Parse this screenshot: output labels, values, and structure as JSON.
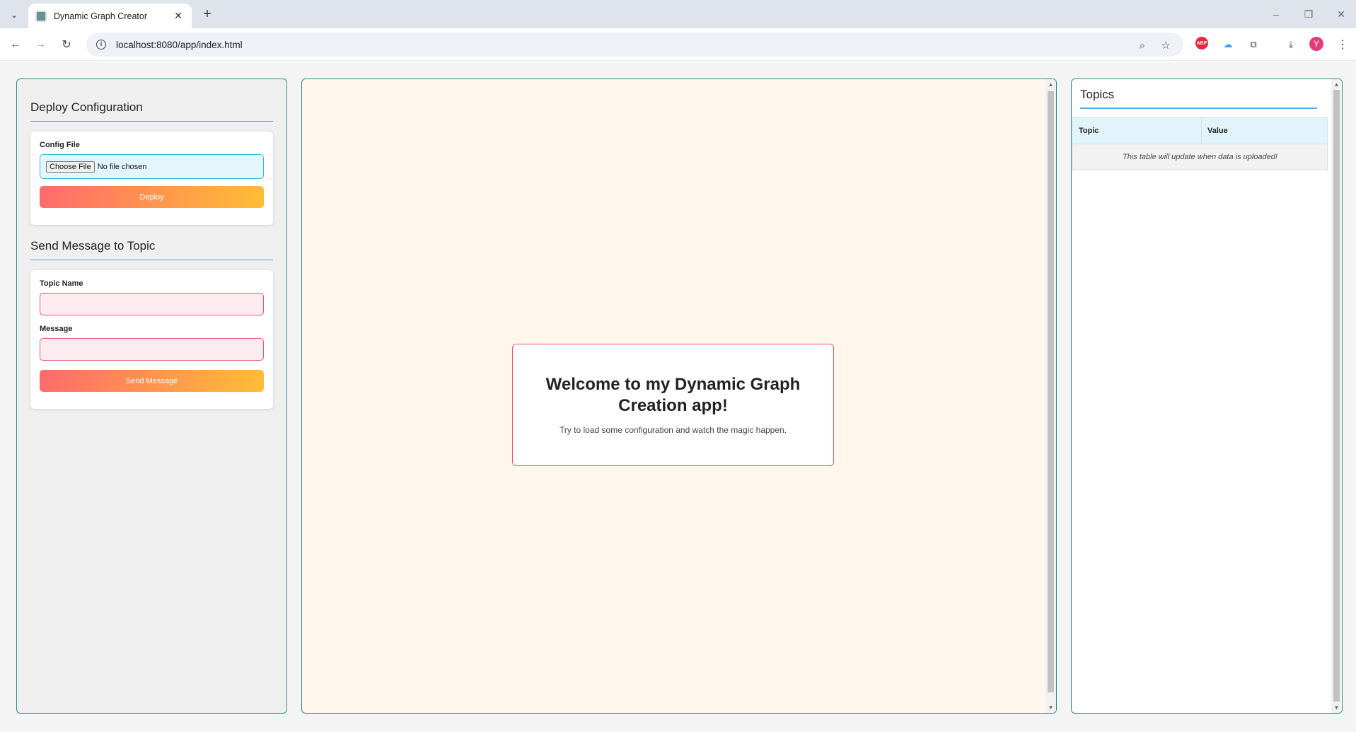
{
  "browser": {
    "tab_title": "Dynamic Graph Creator",
    "url": "localhost:8080/app/index.html",
    "profile_initial": "Y",
    "adblock_label": "ABP"
  },
  "left_panel": {
    "deploy": {
      "title": "Deploy Configuration",
      "config_label": "Config File",
      "choose_file_label": "Choose File",
      "file_status": "No file chosen",
      "deploy_button": "Deploy"
    },
    "send": {
      "title": "Send Message to Topic",
      "topic_label": "Topic Name",
      "topic_value": "",
      "message_label": "Message",
      "message_value": "",
      "send_button": "Send Message"
    }
  },
  "center_panel": {
    "welcome_title": "Welcome to my Dynamic Graph Creation app!",
    "welcome_subtitle": "Try to load some configuration and watch the magic happen."
  },
  "right_panel": {
    "title": "Topics",
    "columns": [
      "Topic",
      "Value"
    ],
    "empty_message": "This table will update when data is uploaded!"
  },
  "colors": {
    "panel_border": "#2a8f88",
    "accent_line": "#45a6cf",
    "gradient_start": "#ff6b6b",
    "gradient_end": "#ffbd35",
    "input_error_border": "#e35b6f"
  }
}
